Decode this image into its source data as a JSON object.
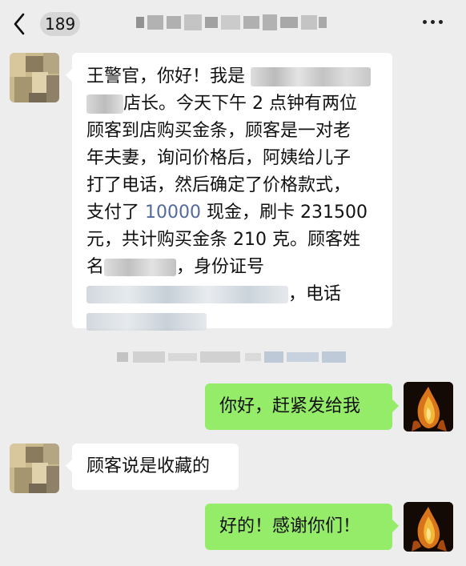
{
  "header": {
    "back_count": "189",
    "title": "",
    "back_icon": "chevron-left-icon",
    "more_icon": "more-horizontal-icon"
  },
  "messages": [
    {
      "sender": "other",
      "lines": [
        [
          "王警官，你好！我是",
          "",
          ""
        ],
        [
          "",
          "店长。今天下午 2 点钟有两位",
          ""
        ],
        [
          "顾客到店购买金条，顾客是一对老",
          "",
          ""
        ],
        [
          "年夫妻，询问价格后，阿姨给儿子",
          "",
          ""
        ],
        [
          "打了电话，然后确定了价格款式，",
          "",
          ""
        ],
        [
          "支付了 ",
          "10000",
          " 现金，刷卡 231500"
        ],
        [
          "元，共计购买金条 210 克。顾客姓",
          "",
          ""
        ],
        [
          "名",
          "",
          "，身份证号"
        ],
        [
          "",
          "，电话",
          ""
        ],
        [
          "",
          "",
          ""
        ]
      ]
    },
    {
      "sender": "me",
      "text": "你好，赶紧发给我"
    },
    {
      "sender": "other",
      "text": "顾客说是收藏的"
    },
    {
      "sender": "me",
      "text": "好的！感谢你们！"
    }
  ],
  "system_note": ""
}
